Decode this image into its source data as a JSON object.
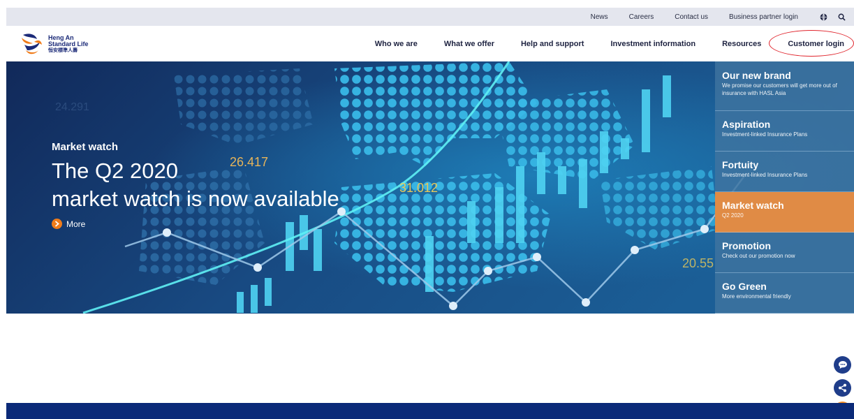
{
  "utility_nav": {
    "links": [
      "News",
      "Careers",
      "Contact us",
      "Business partner login"
    ],
    "globe_icon": "globe-icon",
    "search_icon": "search-icon"
  },
  "brand": {
    "name_line1": "Heng An",
    "name_line2": "Standard Life",
    "name_cn": "恒安標準人壽",
    "logo_colors": [
      "#1b2a78",
      "#f07c1a"
    ]
  },
  "main_nav": {
    "items": [
      "Who we are",
      "What we offer",
      "Help and support",
      "Investment information",
      "Resources",
      "Customer login"
    ]
  },
  "hero": {
    "eyebrow": "Market watch",
    "title_line1": "The Q2 2020",
    "title_line2": "market watch is now available",
    "more_label": "More",
    "figures": [
      "26.417",
      "31.012",
      "20.55",
      "24.291"
    ]
  },
  "side_menu": {
    "items": [
      {
        "title": "Our new brand",
        "subtitle": "We promise our customers will get more out of insurance with HASL Asia"
      },
      {
        "title": "Aspiration",
        "subtitle": "Investment-linked Insurance Plans"
      },
      {
        "title": "Fortuity",
        "subtitle": "Investment-linked Insurance Plans"
      },
      {
        "title": "Market watch",
        "subtitle": "Q2 2020"
      },
      {
        "title": "Promotion",
        "subtitle": "Check out our promotion now"
      },
      {
        "title": "Go Green",
        "subtitle": "More environmental friendly"
      }
    ],
    "active_index": 3,
    "active_color": "#e08b45"
  },
  "floating": {
    "chat_icon": "chat-icon",
    "share_icon": "share-icon",
    "up_icon": "chevron-up-icon"
  },
  "colors": {
    "brand_navy": "#0b2a78",
    "accent_orange": "#f07c1a",
    "highlight_ring": "#e0242c"
  }
}
